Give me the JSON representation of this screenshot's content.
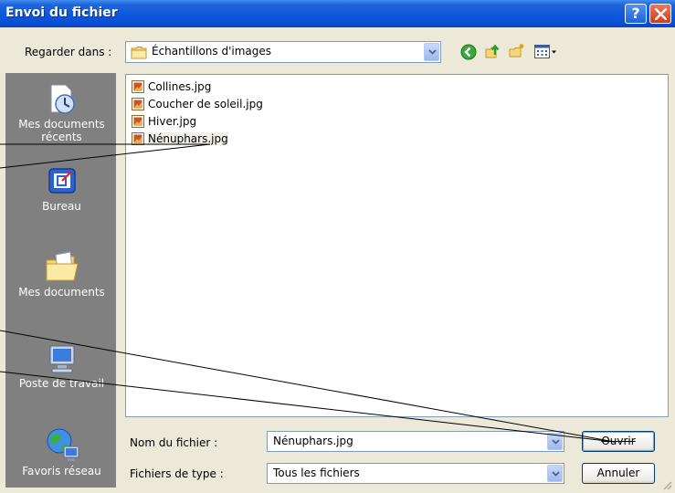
{
  "window": {
    "title": "Envoi du fichier",
    "help_label": "?"
  },
  "toolbar": {
    "look_in_label": "Regarder dans :",
    "look_in_value": "Échantillons d'images",
    "icons": [
      "back-icon",
      "up-folder-icon",
      "new-folder-icon",
      "view-menu-icon"
    ]
  },
  "places": [
    {
      "label": "Mes documents récents",
      "icon": "recent-documents-icon"
    },
    {
      "label": "Bureau",
      "icon": "desktop-icon"
    },
    {
      "label": "Mes documents",
      "icon": "my-documents-icon"
    },
    {
      "label": "Poste de travail",
      "icon": "my-computer-icon"
    },
    {
      "label": "Favoris réseau",
      "icon": "network-places-icon"
    }
  ],
  "files": [
    {
      "name": "Collines.jpg",
      "selected": false
    },
    {
      "name": "Coucher de soleil.jpg",
      "selected": false
    },
    {
      "name": "Hiver.jpg",
      "selected": false
    },
    {
      "name": "Nénuphars.jpg",
      "selected": true
    }
  ],
  "filename": {
    "label": "Nom du fichier :",
    "value": "Nénuphars.jpg"
  },
  "filetype": {
    "label": "Fichiers de type :",
    "value": "Tous les fichiers"
  },
  "buttons": {
    "open_label": "Ouvrir",
    "cancel_label": "Annuler"
  },
  "colors": {
    "titlebar": "#0a58e0",
    "places_bg": "#808080",
    "dialog_bg": "#ece9d8"
  }
}
